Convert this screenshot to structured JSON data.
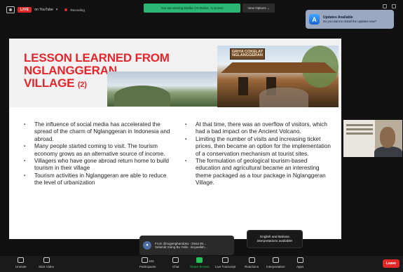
{
  "topbar": {
    "live_label": "LIVE",
    "live_destination": "on YouTube",
    "recording_label": "Recording",
    "viewing_banner": "You are viewing Dedha T.N Rahar...'s screen",
    "view_options": "View Options ⌄"
  },
  "notification": {
    "title": "Updates Available",
    "body": "Do you want to install the updates now?"
  },
  "slide": {
    "title_line1": "LESSON LEARNED FROM NGLANGGERAN",
    "title_line2": "VILLAGE",
    "title_number": "(2)",
    "sign_text": "GRIYA COKELAT NGLANGGERAN",
    "left_bullets": [
      "The influence of social media has accelerated the spread of the charm of Nglanggeran in Indonesia and abroad.",
      "Many people started coming to visit. The tourism economy grows as an alternative source of income.",
      "Villagers who have gone abroad return home to build tourism in their village",
      "Tourism activities in Nglanggeran are able to reduce the level of urbanization"
    ],
    "right_bullets": [
      "At that time, there was an overflow of visitors, which had a bad impact on the Ancient Volcano.",
      "Limiting the number of visits and increasing ticket prices, then became an option for the implementation of a conservation mechanism at tourist sites.",
      "The formulation of geological tourism-based education and agricultural became an interesting theme packaged as a tour package in Nglanggeran Village."
    ]
  },
  "chat_popup": {
    "line1": "From @sugenghandoko - Desa Wi...",
    "line2": "Selamat Siang Bu Yulie.. insyaallah..."
  },
  "interpretation_popup": {
    "line1": "English and Bahasa",
    "line2": "interpretations available!"
  },
  "toolbar": {
    "unmute": "Unmute",
    "start_video": "Start Video",
    "participants": "Participants",
    "participants_count": "163",
    "chat": "Chat",
    "share_screen": "Share Screen",
    "live_transcript": "Live Transcript",
    "reactions": "Reactions",
    "interpretation": "Interpretation",
    "apps": "Apps",
    "leave": "Leave"
  }
}
